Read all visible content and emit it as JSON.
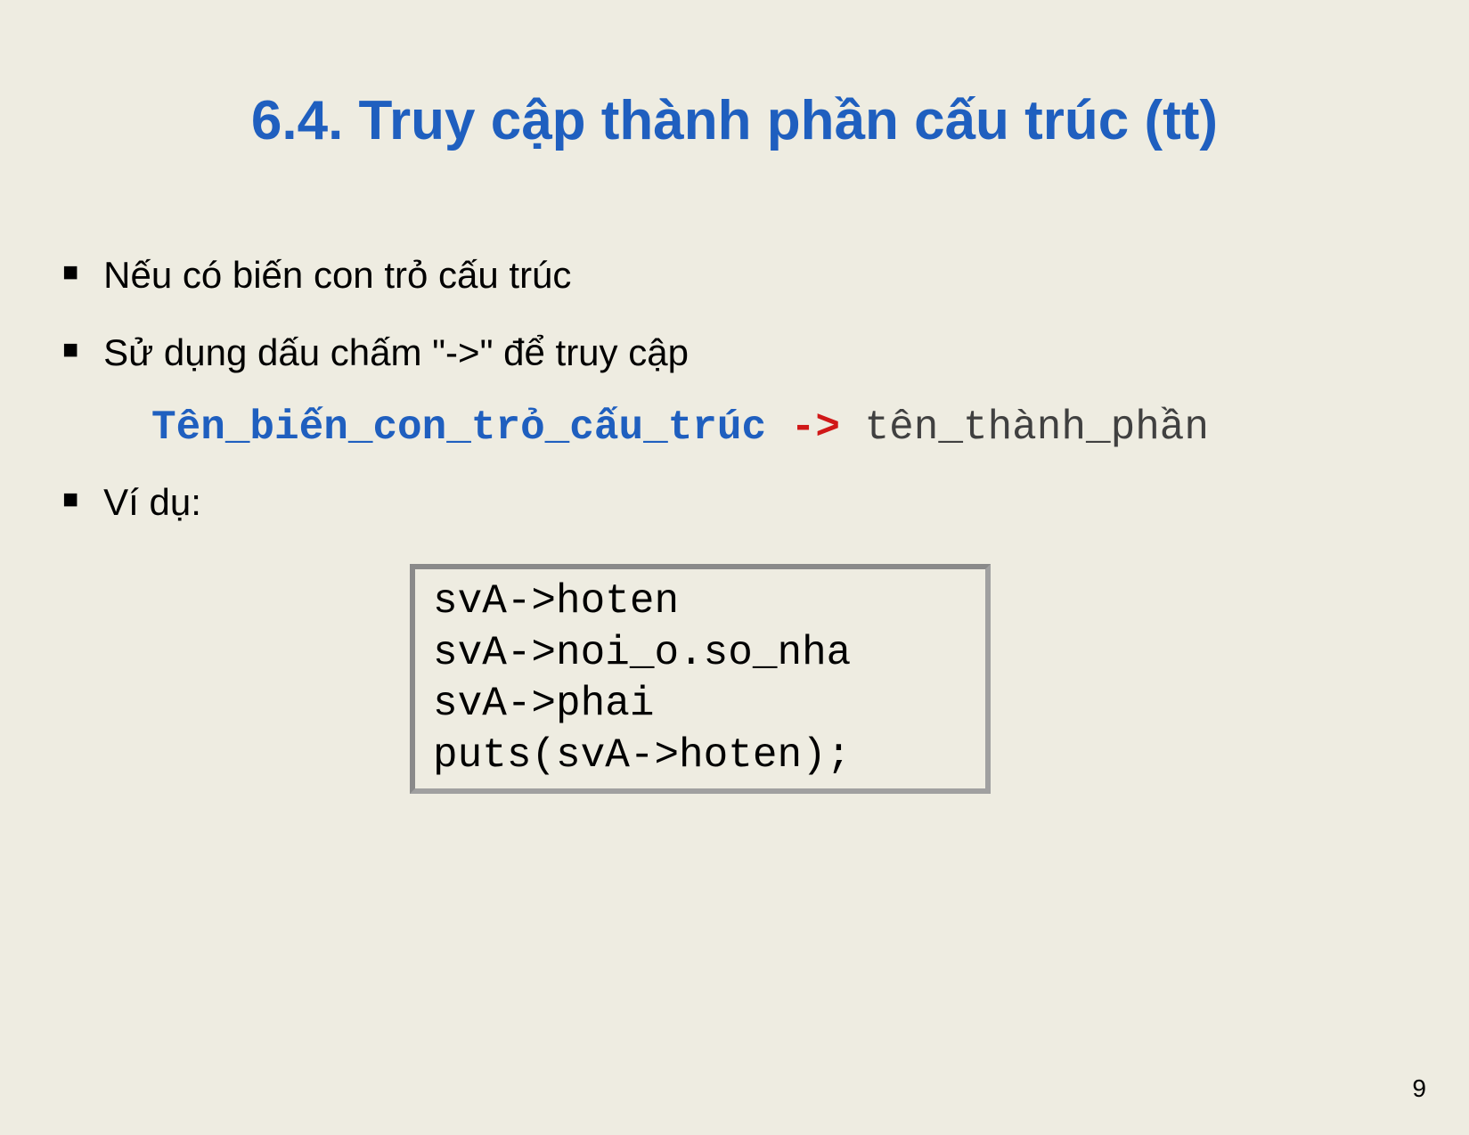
{
  "title": "6.4. Truy cập thành phần cấu trúc (tt)",
  "bullets": {
    "b1": "Nếu có biến con trỏ cấu trúc",
    "b2": "Sử dụng dấu chấm \"->\" để truy cập",
    "b3": "Ví dụ:"
  },
  "syntax": {
    "var": "Tên_biến_con_trỏ_cấu_trúc",
    "op": " -> ",
    "member": "tên_thành_phần"
  },
  "code_lines": "svA->hoten\nsvA->noi_o.so_nha\nsvA->phai\nputs(svA->hoten);",
  "page_number": "9"
}
